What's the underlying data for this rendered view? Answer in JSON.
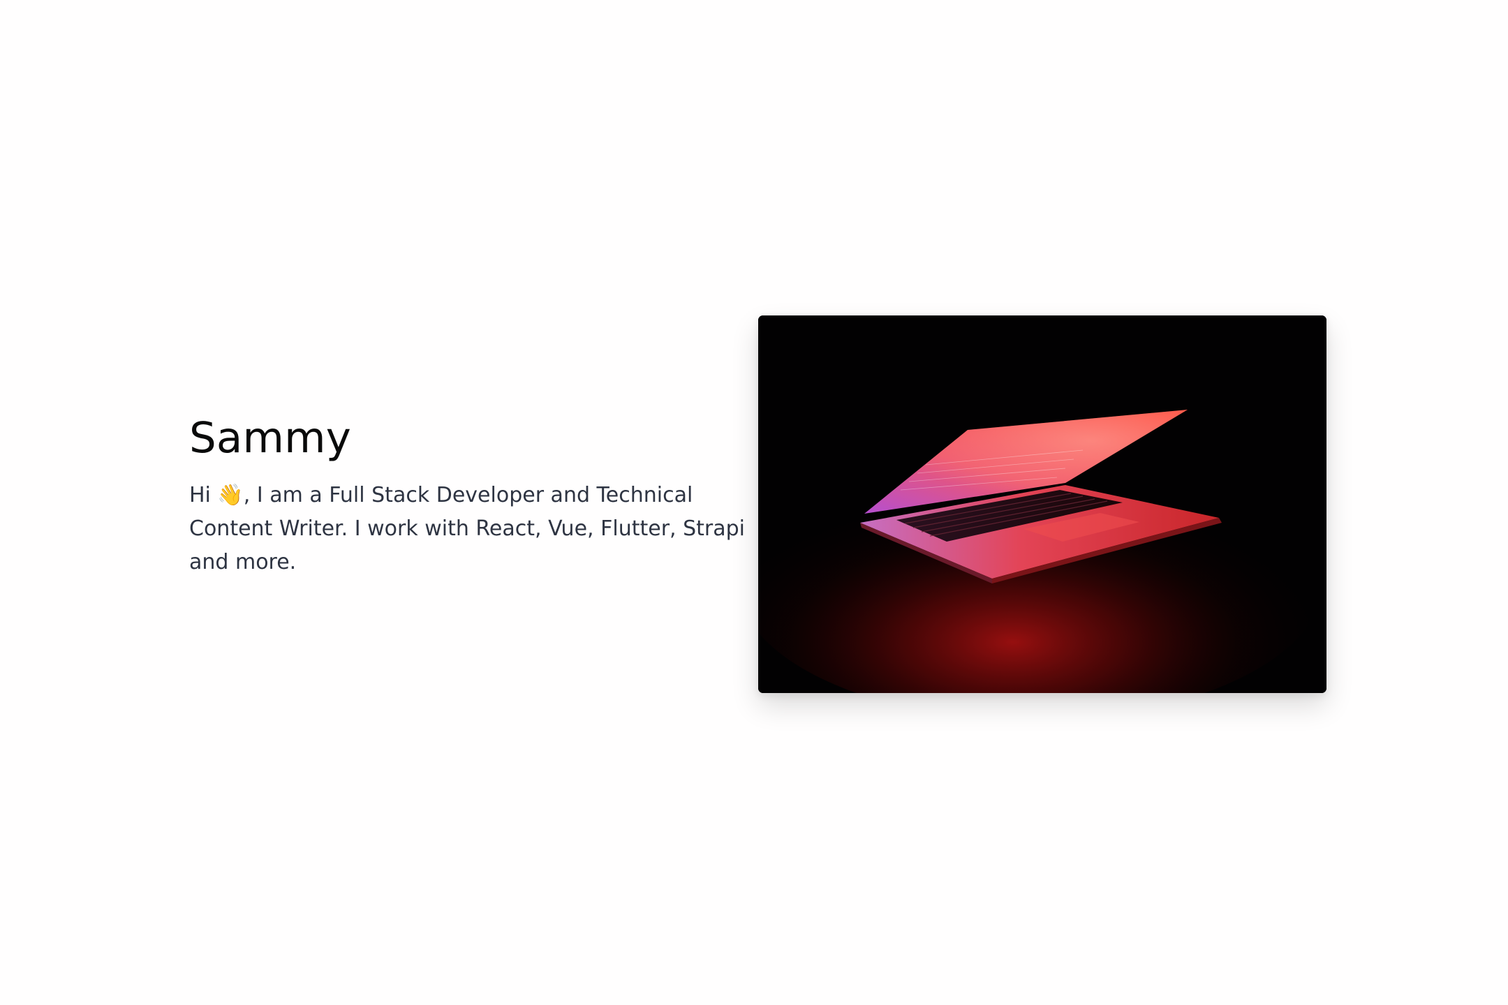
{
  "hero": {
    "name": "Sammy",
    "bio": "Hi 👋, I am a Full Stack Developer and Technical Content Writer. I work with React, Vue, Flutter, Strapi and more.",
    "image": {
      "alt": "laptop-with-red-glow"
    },
    "colors": {
      "background": "#fffefe",
      "title": "#0a0a0a",
      "body": "#2e3442",
      "glow": "#ff3a3a"
    }
  }
}
